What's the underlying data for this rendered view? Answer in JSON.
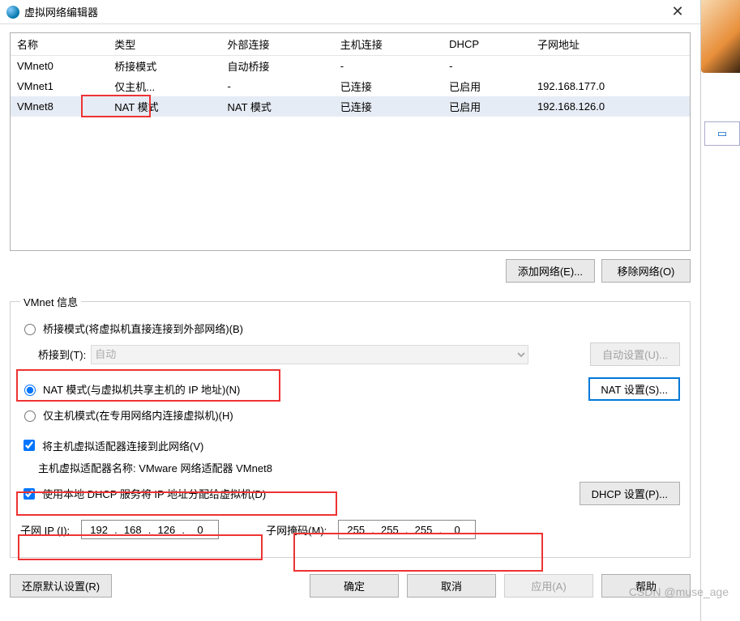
{
  "window": {
    "title": "虚拟网络编辑器",
    "close_glyph": "✕"
  },
  "table": {
    "headers": [
      "名称",
      "类型",
      "外部连接",
      "主机连接",
      "DHCP",
      "子网地址"
    ],
    "rows": [
      {
        "name": "VMnet0",
        "type": "桥接模式",
        "ext": "自动桥接",
        "host": "-",
        "dhcp": "-",
        "subnet": ""
      },
      {
        "name": "VMnet1",
        "type": "仅主机...",
        "ext": "-",
        "host": "已连接",
        "dhcp": "已启用",
        "subnet": "192.168.177.0"
      },
      {
        "name": "VMnet8",
        "type": "NAT 模式",
        "ext": "NAT 模式",
        "host": "已连接",
        "dhcp": "已启用",
        "subnet": "192.168.126.0"
      }
    ]
  },
  "buttons": {
    "add_network": "添加网络(E)...",
    "remove_network": "移除网络(O)",
    "auto_settings": "自动设置(U)...",
    "nat_settings": "NAT 设置(S)...",
    "dhcp_settings": "DHCP 设置(P)...",
    "restore_defaults": "还原默认设置(R)",
    "ok": "确定",
    "cancel": "取消",
    "apply": "应用(A)",
    "help": "帮助"
  },
  "info": {
    "legend": "VMnet 信息",
    "bridge_radio": "桥接模式(将虚拟机直接连接到外部网络)(B)",
    "bridge_to_label": "桥接到(T):",
    "bridge_to_value": "自动",
    "nat_radio": "NAT 模式(与虚拟机共享主机的 IP 地址)(N)",
    "hostonly_radio": "仅主机模式(在专用网络内连接虚拟机)(H)",
    "connect_host_chk": "将主机虚拟适配器连接到此网络(V)",
    "adapter_name_label": "主机虚拟适配器名称: VMware 网络适配器 VMnet8",
    "dhcp_chk": "使用本地 DHCP 服务将 IP 地址分配给虚拟机(D)",
    "subnet_ip_label": "子网 IP (I):",
    "subnet_ip": [
      "192",
      "168",
      "126",
      "0"
    ],
    "subnet_mask_label": "子网掩码(M):",
    "subnet_mask": [
      "255",
      "255",
      "255",
      "0"
    ]
  },
  "watermark": "CSDN @muse_age"
}
